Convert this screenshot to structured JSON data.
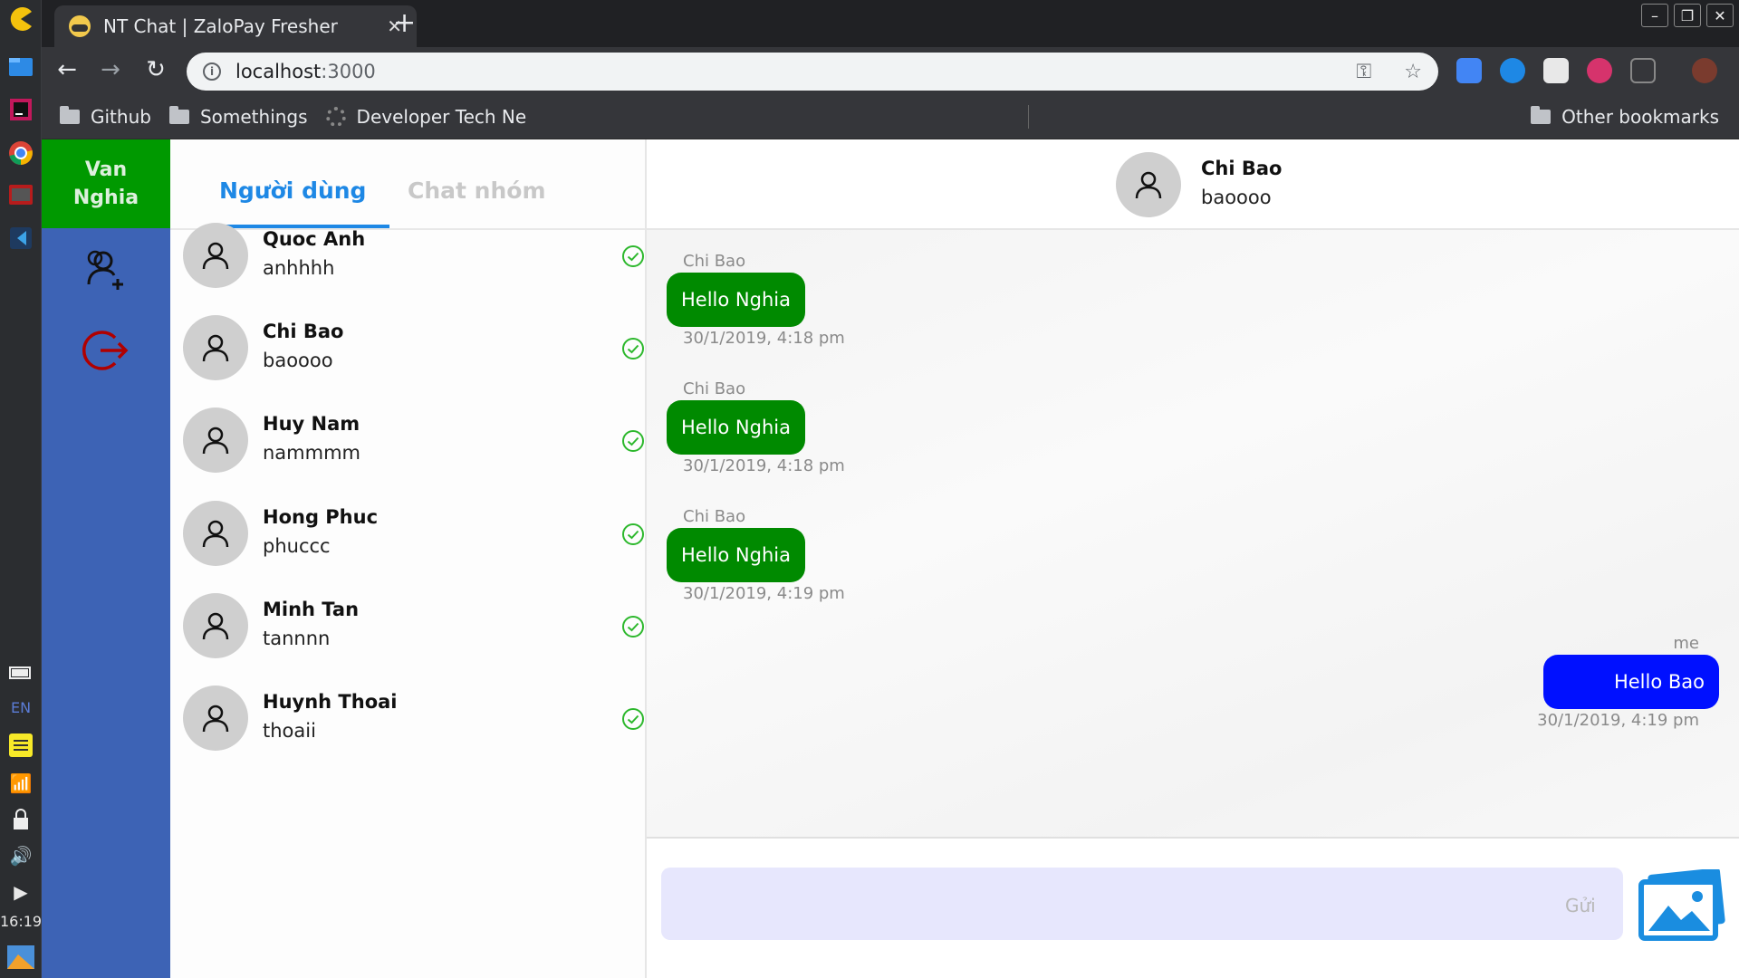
{
  "browser": {
    "tab_title": "NT Chat | ZaloPay Fresher",
    "url_host": "localhost",
    "url_port": ":3000",
    "bookmarks": [
      "Github",
      "Somethings",
      "Developer Tech Ne"
    ],
    "other_bookmarks": "Other bookmarks"
  },
  "os": {
    "lang": "EN",
    "clock": "16:19"
  },
  "sidebar": {
    "user_first": "Van",
    "user_last": "Nghia"
  },
  "tabs": {
    "users": "Người dùng",
    "groups": "Chat nhóm"
  },
  "users": [
    {
      "name": "Quoc Anh",
      "username": "anhhhh"
    },
    {
      "name": "Chi Bao",
      "username": "baoooo"
    },
    {
      "name": "Huy Nam",
      "username": "nammmm"
    },
    {
      "name": "Hong Phuc",
      "username": "phuccc"
    },
    {
      "name": "Minh Tan",
      "username": "tannnn"
    },
    {
      "name": "Huynh Thoai",
      "username": "thoaii"
    }
  ],
  "chat": {
    "name": "Chi Bao",
    "username": "baoooo",
    "messages": [
      {
        "sender": "Chi Bao",
        "text": "Hello Nghia",
        "time": "30/1/2019, 4:18 pm"
      },
      {
        "sender": "Chi Bao",
        "text": "Hello Nghia",
        "time": "30/1/2019, 4:18 pm"
      },
      {
        "sender": "Chi Bao",
        "text": "Hello Nghia",
        "time": "30/1/2019, 4:19 pm"
      },
      {
        "sender": "me",
        "text": "Hello Bao",
        "time": "30/1/2019, 4:19 pm"
      }
    ],
    "send_label": "Gửi"
  },
  "colors": {
    "online": "#2db82d",
    "my_bubble": "#0010ff",
    "their_bubble": "#008a00"
  }
}
